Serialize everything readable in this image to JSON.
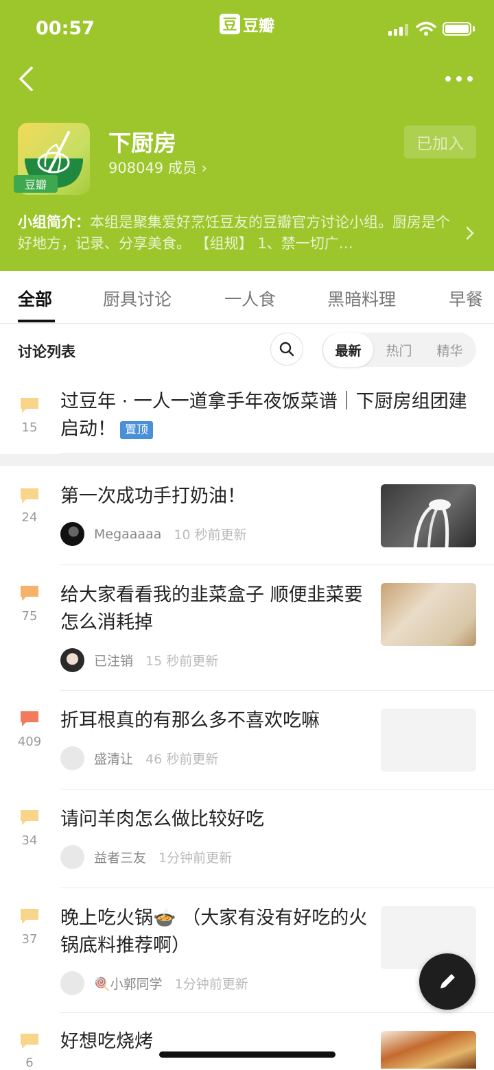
{
  "status": {
    "time": "00:57",
    "app_logo_char": "豆",
    "app_name": "豆瓣"
  },
  "group": {
    "avatar_badge": "豆瓣",
    "name": "下厨房",
    "members": "908049 成员 ›",
    "join_label": "已加入",
    "intro_label": "小组简介：",
    "intro_text": "本组是聚集爱好烹饪豆友的豆瓣官方讨论小组。厨房是个好地方，记录、分享美食。 【组规】 1、禁一切广…"
  },
  "tabs": [
    "全部",
    "厨具讨论",
    "一人食",
    "黑暗料理",
    "早餐"
  ],
  "list": {
    "title": "讨论列表",
    "sort_options": [
      "最新",
      "热门",
      "精华"
    ]
  },
  "pinned": {
    "count": "15",
    "title": "过豆年 · 一人一道拿手年夜饭菜谱｜下厨房组团建启动！",
    "badge": "置顶"
  },
  "posts": [
    {
      "count": "24",
      "title": "第一次成功手打奶油！",
      "author": "Megaaaaa",
      "time": "10 秒前更新"
    },
    {
      "count": "75",
      "title": "给大家看看我的韭菜盒子 顺便韭菜要怎么消耗掉",
      "author": "已注销",
      "time": "15 秒前更新"
    },
    {
      "count": "409",
      "title": "折耳根真的有那么多不喜欢吃嘛",
      "author": "盛清让",
      "time": "46 秒前更新"
    },
    {
      "count": "34",
      "title": "请问羊肉怎么做比较好吃",
      "author": "益者三友",
      "time": "1分钟前更新"
    },
    {
      "count": "37",
      "title": "晚上吃火锅🍲 （大家有没有好吃的火锅底料推荐啊）",
      "author": "🍭小郭同学",
      "time": "1分钟前更新"
    },
    {
      "count": "6",
      "title": "好想吃烧烤",
      "author": "",
      "time": ""
    }
  ],
  "colors": {
    "header_green": "#9cc62b",
    "bubble_light": "#f9d48b",
    "bubble_mid": "#f7b26a",
    "bubble_hot": "#f27b5c",
    "pin_blue": "#4a90d9"
  },
  "icons": [
    "back-icon",
    "more-icon",
    "chevron-right-icon",
    "search-icon",
    "comment-bubble-icon",
    "pen-icon"
  ]
}
